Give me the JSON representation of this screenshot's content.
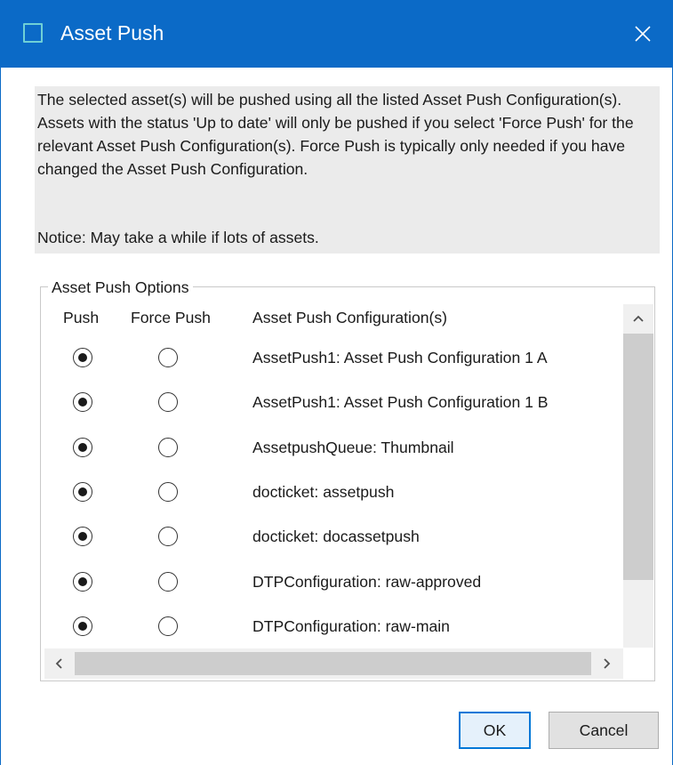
{
  "window": {
    "title": "Asset Push",
    "close_glyph": "✕"
  },
  "info": {
    "description": "The selected asset(s) will be pushed using all the listed Asset Push Configuration(s). Assets with the status 'Up to date' will only be pushed if you select 'Force Push' for the relevant Asset Push Configuration(s). Force Push is typically only needed if you have changed the Asset Push Configuration.",
    "notice": "Notice: May take a while if lots of assets."
  },
  "options": {
    "legend": "Asset Push Options",
    "headers": {
      "push": "Push",
      "force_push": "Force Push",
      "configuration": "Asset Push Configuration(s)"
    },
    "rows": [
      {
        "label": "AssetPush1: Asset Push Configuration 1 A",
        "push": true,
        "force_push": false
      },
      {
        "label": "AssetPush1: Asset Push Configuration 1 B",
        "push": true,
        "force_push": false
      },
      {
        "label": "AssetpushQueue: Thumbnail",
        "push": true,
        "force_push": false
      },
      {
        "label": "docticket: assetpush",
        "push": true,
        "force_push": false
      },
      {
        "label": "docticket: docassetpush",
        "push": true,
        "force_push": false
      },
      {
        "label": "DTPConfiguration: raw-approved",
        "push": true,
        "force_push": false
      },
      {
        "label": "DTPConfiguration: raw-main",
        "push": true,
        "force_push": false
      }
    ]
  },
  "buttons": {
    "ok": "OK",
    "cancel": "Cancel"
  },
  "colors": {
    "titlebar": "#0b6ac7",
    "accent": "#0078d7"
  }
}
